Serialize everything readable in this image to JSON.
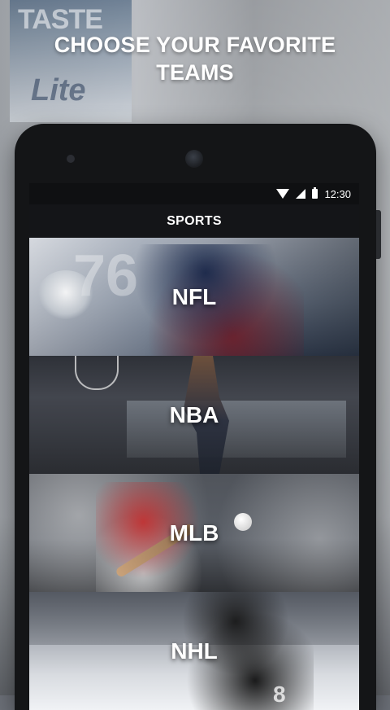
{
  "headline": {
    "text": "CHOOSE YOUR FAVORITE\nTEAMS"
  },
  "background": {
    "billboard_text_1": "TASTE",
    "billboard_text_2": "Lite"
  },
  "phone": {
    "status": {
      "time": "12:30",
      "icons": [
        "wifi-icon",
        "signal-icon",
        "battery-icon"
      ]
    },
    "appbar": {
      "title": "SPORTS"
    },
    "sports": [
      {
        "label": "NFL"
      },
      {
        "label": "NBA"
      },
      {
        "label": "MLB"
      },
      {
        "label": "NHL"
      }
    ]
  },
  "colors": {
    "headline": "#ffffff",
    "phone_frame": "#141517",
    "appbar": "#141518"
  }
}
